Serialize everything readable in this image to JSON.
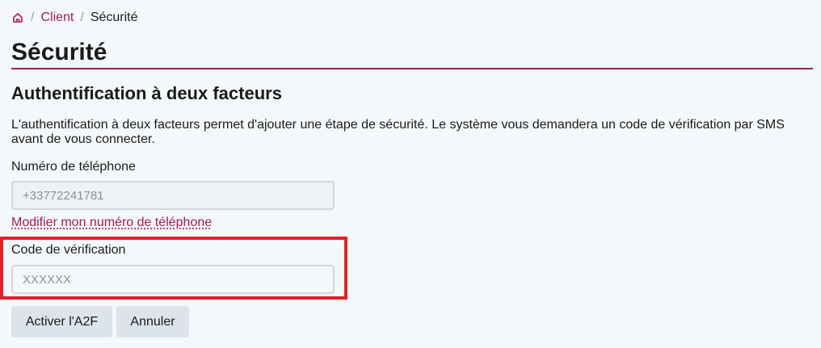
{
  "breadcrumb": {
    "home_icon": "home-icon",
    "separator": "/",
    "client": "Client",
    "current": "Sécurité"
  },
  "page": {
    "title": "Sécurité",
    "accent_color": "#a3195b"
  },
  "two_factor": {
    "title": "Authentification à deux facteurs",
    "description": "L'authentification à deux facteurs permet d'ajouter une étape de sécurité. Le système vous demandera un code de vérification par SMS avant de vous connecter.",
    "phone_label": "Numéro de téléphone",
    "phone_placeholder": "+33772241781",
    "change_phone_link": "Modifier mon numéro de téléphone",
    "code_label": "Code de vérification",
    "code_placeholder": "XXXXXX",
    "highlight_color": "#e3202b"
  },
  "actions": {
    "activate": "Activer l'A2F",
    "cancel": "Annuler"
  }
}
